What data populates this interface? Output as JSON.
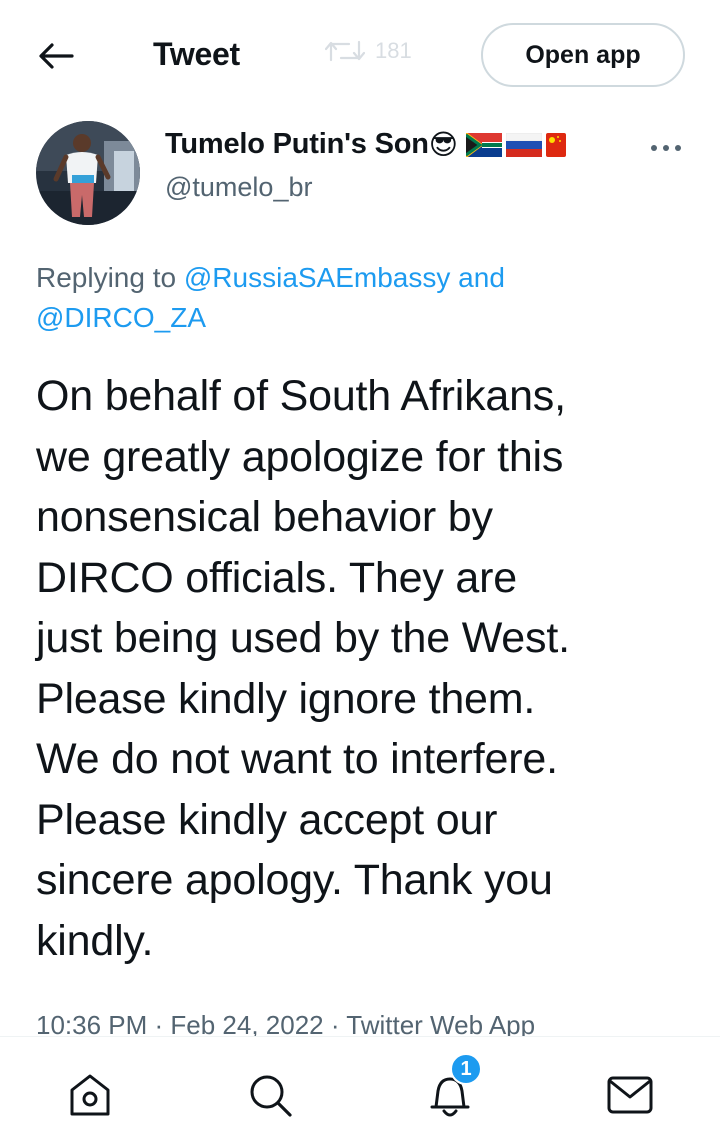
{
  "header": {
    "title": "Tweet",
    "retweet_count": "181",
    "open_app_label": "Open app",
    "back_icon": "arrow-left-icon"
  },
  "tweet": {
    "display_name": "Tumelo Putin's Son",
    "name_emoji": "😎",
    "flags": [
      "south-africa-flag-icon",
      "russia-flag-icon",
      "china-flag-icon"
    ],
    "handle": "@tumelo_br",
    "replying_prefix": "Replying to",
    "replying_mention_1": "@RussiaSAEmbassy",
    "replying_and": "and",
    "replying_mention_2": "@DIRCO_ZA",
    "text": "On behalf of South Afrikans,\nwe greatly apologize for this\nnonsensical behavior by\nDIRCO officials. They are\njust being used by the West.\nPlease kindly ignore them.\nWe do not want to interfere.\nPlease kindly accept our\nsincere apology. Thank you\nkindly.",
    "meta": "10:36 PM · Feb 24, 2022 · Twitter Web App"
  },
  "bottom_nav": {
    "items": [
      "home-icon",
      "search-icon",
      "notifications-icon",
      "messages-icon"
    ],
    "notifications_badge": "1"
  },
  "colors": {
    "accent": "#1d9bf0",
    "text_primary": "#0f1419",
    "text_secondary": "#536471"
  }
}
